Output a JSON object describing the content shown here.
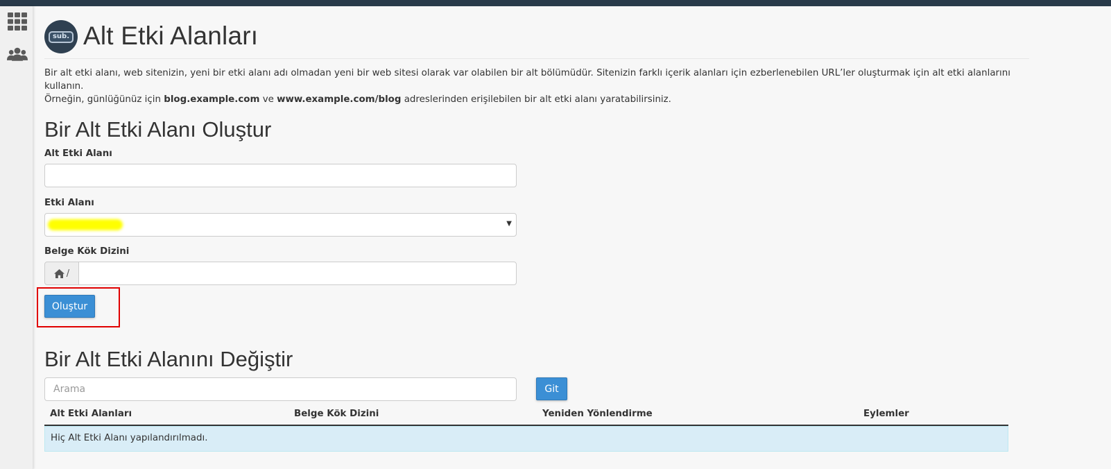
{
  "header": {
    "title": "Alt Etki Alanları",
    "logo_text": "sub."
  },
  "sidebar": {
    "items": [
      {
        "icon": "apps-grid-icon"
      },
      {
        "icon": "users-icon"
      }
    ]
  },
  "description": {
    "line1": "Bir alt etki alanı, web sitenizin, yeni bir etki alanı adı olmadan yeni bir web sitesi olarak var olabilen bir alt bölümüdür. Sitenizin farklı içerik alanları için ezberlenebilen URL’ler oluşturmak için alt etki alanlarını kullanın.",
    "line2_prefix": "Örneğin, günlüğünüz için ",
    "example1": "blog.example.com",
    "line2_mid": " ve ",
    "example2": "www.example.com/blog",
    "line2_suffix": " adreslerinden erişilebilen bir alt etki alanı yaratabilirsiniz."
  },
  "create_section": {
    "title": "Bir Alt Etki Alanı Oluştur",
    "subdomain_label": "Alt Etki Alanı",
    "subdomain_value": "",
    "domain_label": "Etki Alanı",
    "domain_selected": "",
    "docroot_label": "Belge Kök Dizini",
    "docroot_prefix": "/",
    "docroot_value": "",
    "create_button": "Oluştur"
  },
  "modify_section": {
    "title": "Bir Alt Etki Alanını Değiştir",
    "search_placeholder": "Arama",
    "go_button": "Git",
    "columns": [
      "Alt Etki Alanları",
      "Belge Kök Dizini",
      "Yeniden Yönlendirme",
      "Eylemler"
    ],
    "empty_message": "Hiç Alt Etki Alanı yapılandırılmadı."
  },
  "colors": {
    "primary": "#3b8fd5",
    "topbar": "#293a4a",
    "info_row": "#d9edf7",
    "highlight": "#e00000"
  }
}
